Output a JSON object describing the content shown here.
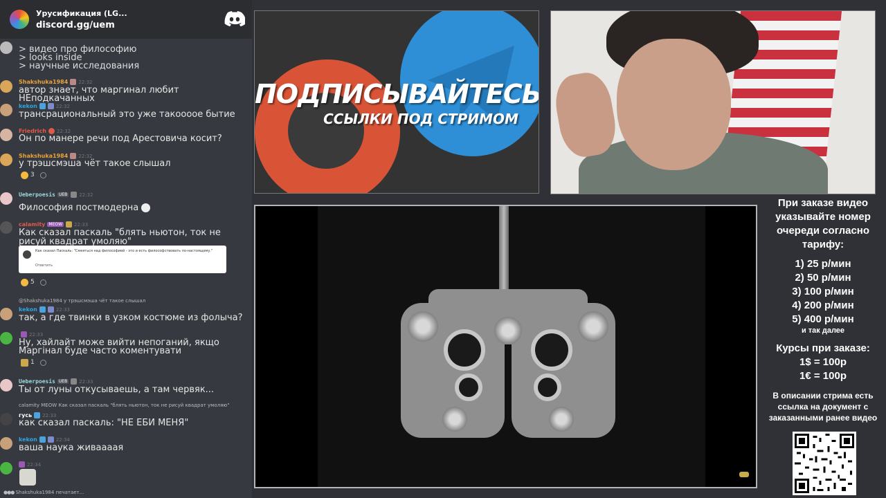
{
  "server": {
    "name": "Урусификация (LG...",
    "invite": "discord.gg/uem",
    "icon": "server-icon",
    "app_icon": "discord-logo-icon"
  },
  "messages": [
    {
      "id": "m0",
      "lines": [
        "> видео про философию",
        "> looks inside",
        "> научные исследования"
      ]
    },
    {
      "id": "m1",
      "user": "Shakshuka1984",
      "user_color": "#e9a23b",
      "time": "22:32",
      "text": "автор знает, что маргинал любит НЕподкачанных"
    },
    {
      "id": "m2",
      "user": "kekon",
      "user_color": "#2fa5e0",
      "time": "22:32",
      "text": "трансрациональный это уже такоооое бытие"
    },
    {
      "id": "m3",
      "user": "Friedrich",
      "user_color": "#e05a4a",
      "time": "22:32",
      "text": "Он по манере речи под Арестовича косит?"
    },
    {
      "id": "m4",
      "user": "Shakshuka1984",
      "user_color": "#e9a23b",
      "time": "22:32",
      "text": "у трэшсмэша чёт такое слышал",
      "reaction_count": "3"
    },
    {
      "id": "m5",
      "user": "Ueberpoesis",
      "user_color": "#9ddce0",
      "tag": "UEB",
      "time": "22:32",
      "text": "Философия постмодерна"
    },
    {
      "id": "m6",
      "user": "calamity",
      "user_color": "#e05a4a",
      "tag": "MEOW",
      "time": "22:33",
      "text": "Как сказал паскаль \"блять ньютон, ток не рисуй квадрат умоляю\"",
      "embed_text": "Как сказал Паскаль: \"Смеяться над философией - это и есть философствовать по-настоящему.\"",
      "embed_reply": "Ответить",
      "reaction_count": "5"
    },
    {
      "id": "m7",
      "reply": "@Shakshuka1984 у трэшсмэша чёт такое слышал",
      "user": "kekon",
      "user_color": "#2fa5e0",
      "time": "22:33",
      "text": "так, а где твинки в узком костюме из фолыча?"
    },
    {
      "id": "m8",
      "user": "",
      "time": "22:33",
      "text": "Ну, хайлайт може вийти непоганий, якщо Маргінал буде часто коментувати",
      "reaction_count": "1"
    },
    {
      "id": "m9",
      "user": "Ueberpoesis",
      "user_color": "#9ddce0",
      "tag": "UEB",
      "time": "22:33",
      "text": "Ты от луны откусываешь, а там червяк..."
    },
    {
      "id": "m10",
      "reply": "calamity MEOW Как сказал паскаль \"блять ньютон, ток не рисуй квадрат умоляю\"",
      "user": "гусь",
      "user_color": "#ffffff",
      "time": "22:33",
      "text": "как сказал паскаль: \"НЕ ЕБИ МЕНЯ\""
    },
    {
      "id": "m11",
      "user": "kekon",
      "user_color": "#2fa5e0",
      "time": "22:34",
      "text": "ваша наука живаааая"
    },
    {
      "id": "m12",
      "user": "",
      "time": "22:34",
      "text": ""
    }
  ],
  "typing": "Shakshuka1984 печатает...",
  "promo": {
    "title": "ПОДПИСЫВАЙТЕСЬ",
    "subtitle": "ССЫЛКИ ПОД СТРИМОМ"
  },
  "info": {
    "order_note": "При заказе видео указывайте номер очереди согласно тарифу:",
    "tariffs": [
      "1) 25 р/мин",
      "2) 50 р/мин",
      "3) 100 р/мин",
      "4) 200 р/мин",
      "5) 400 р/мин"
    ],
    "more": "и так далее",
    "courses_title": "Курсы при заказе:",
    "courses": [
      "1$ = 100р",
      "1€ = 100р"
    ],
    "desc_note": "В описании стрима есть ссылка на документ с заказанными ранее видео"
  }
}
